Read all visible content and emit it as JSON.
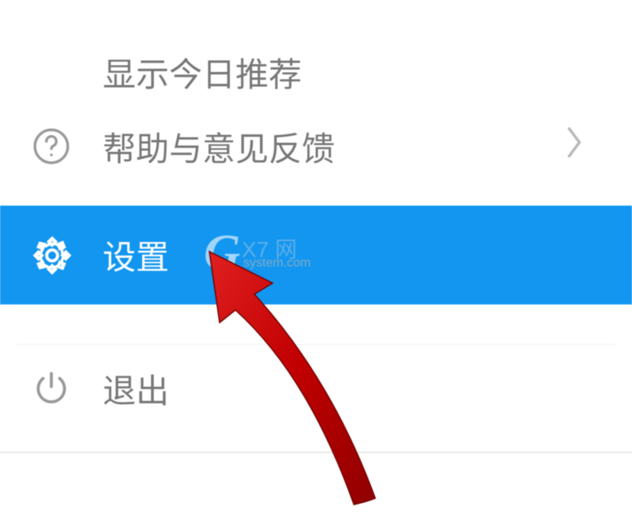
{
  "menu": {
    "recommend": {
      "label": "显示今日推荐"
    },
    "help": {
      "label": "帮助与意见反馈"
    },
    "settings": {
      "label": "设置"
    },
    "exit": {
      "label": "退出"
    }
  },
  "watermark": {
    "brand_letter": "G",
    "brand_suffix": "X7 网",
    "subtext": "system.com"
  },
  "colors": {
    "highlight_bg": "#1296f0",
    "highlight_text": "#ffffff",
    "normal_text": "#777777",
    "arrow_fill": "#cc0000"
  }
}
